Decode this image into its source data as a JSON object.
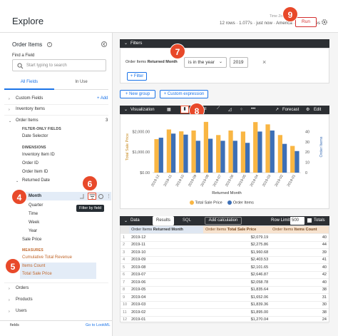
{
  "header": {
    "title": "Explore",
    "meta": "12 rows · 1.077s · just now · America · Los Angeles",
    "timezone_label": "Time Zone",
    "run_label": "Run"
  },
  "badges": [
    "9",
    "7",
    "8",
    "6",
    "4",
    "5"
  ],
  "sidebar": {
    "title": "Order Items",
    "find_label": "Find a Field",
    "search_placeholder": "Start typing to search",
    "tab_all": "All Fields",
    "tab_in_use": "In Use",
    "custom_fields": "Custom Fields",
    "add_label": "+ Add",
    "inventory_items": "Inventory Items",
    "order_items": "Order Items",
    "order_items_count": "3",
    "filter_only": "FILTER-ONLY FIELDS",
    "date_selector": "Date Selector",
    "dimensions": "DIMENSIONS",
    "dims": [
      "Inventory Item ID",
      "Order ID",
      "Order Item ID"
    ],
    "returned_date": "Returned Date",
    "month": "Month",
    "sub_dims": [
      "Quarter",
      "Time",
      "Week",
      "Year"
    ],
    "sale_price": "Sale Price",
    "measures": "MEASURES",
    "cumulative": "Cumulative Total Revenue",
    "items_count": "Items Count",
    "total_sale_price": "Total Sale Price",
    "orders": "Orders",
    "products": "Products",
    "users": "Users",
    "footer_left": "fields",
    "footer_right": "Go to LookML",
    "tooltip": "Filter by field"
  },
  "filters": {
    "header": "Filters",
    "field_prefix": "Order Items",
    "field_name": "Returned Month",
    "operator": "is in the year",
    "value": "2019",
    "add_filter": "+ Filter",
    "new_group": "+ New group",
    "custom_expression": "+ Custom expression"
  },
  "visualization": {
    "header": "Visualization",
    "forecast": "Forecast",
    "edit": "Edit"
  },
  "chart_data": {
    "type": "bar",
    "categories": [
      "2019-12",
      "2019-11",
      "2019-10",
      "2019-09",
      "2019-08",
      "2019-07",
      "2019-06",
      "2019-05",
      "2019-04",
      "2019-03",
      "2019-02",
      "2019-01"
    ],
    "series": [
      {
        "name": "Total Sale Price",
        "axis": "left",
        "color": "#f9b643",
        "values": [
          1630,
          2100,
          2010,
          2050,
          2470,
          1830,
          2050,
          2000,
          2460,
          2350,
          1830,
          1300
        ]
      },
      {
        "name": "Order Items",
        "axis": "right",
        "color": "#3c6fb6",
        "values": [
          34,
          38,
          37,
          31,
          33,
          31,
          31,
          29,
          40,
          41,
          28,
          21
        ]
      }
    ],
    "ylabel_left": "Total Sale Price",
    "ylabel_right": "Order Items",
    "xlabel": "Returned Month",
    "left_ticks": [
      "$2,000.00",
      "$1,000.00",
      "$0.00"
    ],
    "right_ticks": [
      "40",
      "30",
      "20",
      "10",
      "0"
    ],
    "ylim_left": [
      0,
      2500
    ],
    "ylim_right": [
      0,
      50
    ],
    "legend": "bottom"
  },
  "data_panel": {
    "tab_data": "Data",
    "tab_results": "Results",
    "tab_sql": "SQL",
    "add_calc": "Add calculation",
    "row_limit_label": "Row Limit",
    "row_limit": "500",
    "totals": "Totals",
    "col1_prefix": "Order Items",
    "col1_name": "Returned Month",
    "col2_prefix": "Order Items",
    "col2_name": "Total Sale Price",
    "col3_prefix": "Order Items",
    "col3_name": "Items Count",
    "rows": [
      [
        "1",
        "2019-12",
        "$2,079.19",
        "40"
      ],
      [
        "2",
        "2019-11",
        "$2,275.86",
        "44"
      ],
      [
        "3",
        "2019-10",
        "$1,960.68",
        "39"
      ],
      [
        "4",
        "2019-09",
        "$2,403.53",
        "41"
      ],
      [
        "5",
        "2019-08",
        "$2,101.65",
        "40"
      ],
      [
        "6",
        "2019-07",
        "$2,646.87",
        "42"
      ],
      [
        "7",
        "2019-06",
        "$2,058.78",
        "40"
      ],
      [
        "8",
        "2019-05",
        "$1,835.64",
        "38"
      ],
      [
        "9",
        "2019-04",
        "$1,652.06",
        "31"
      ],
      [
        "10",
        "2019-03",
        "$1,839.36",
        "30"
      ],
      [
        "11",
        "2019-02",
        "$1,895.00",
        "38"
      ],
      [
        "12",
        "2019-01",
        "$1,270.04",
        "24"
      ]
    ]
  }
}
